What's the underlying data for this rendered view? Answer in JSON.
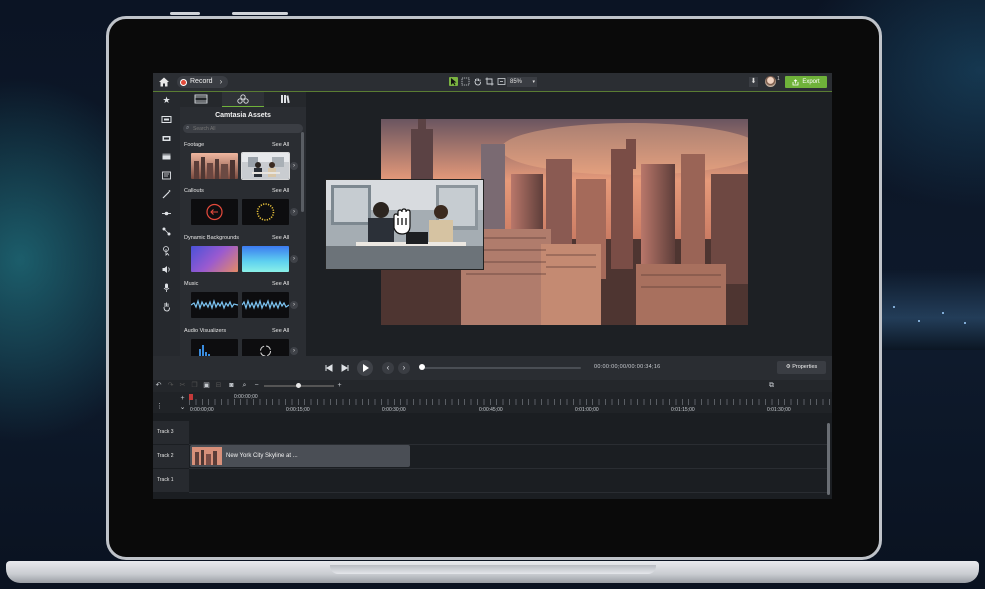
{
  "app": {
    "record_label": "Record",
    "zoom_level": "85%",
    "export_label": "Export",
    "user_badge": "1"
  },
  "assets_panel": {
    "title": "Camtasia Assets",
    "search_placeholder": "Search All",
    "sections": [
      {
        "label": "Footage",
        "see_all": "See All"
      },
      {
        "label": "Callouts",
        "see_all": "See All"
      },
      {
        "label": "Dynamic Backgrounds",
        "see_all": "See All"
      },
      {
        "label": "Music",
        "see_all": "See All"
      },
      {
        "label": "Audio Visualizers",
        "see_all": "See All"
      }
    ]
  },
  "playback": {
    "time_readout": "00:00:00;00/00:00:34;16",
    "properties_label": "Properties"
  },
  "timeline": {
    "playhead_time": "0:00:00;00",
    "ruler_labels": [
      "0:00:00;00",
      "0:00:15;00",
      "0:00:30;00",
      "0:00:45;00",
      "0:01:00;00",
      "0:01:15;00",
      "0:01:30;00"
    ],
    "tracks": [
      {
        "label": "Track 3"
      },
      {
        "label": "Track 2"
      },
      {
        "label": "Track 1"
      }
    ],
    "clip_label": "New York City Skyline at ..."
  },
  "colors": {
    "accent": "#6fb23a",
    "record": "#e24b3a",
    "panel": "#2a2d32"
  }
}
